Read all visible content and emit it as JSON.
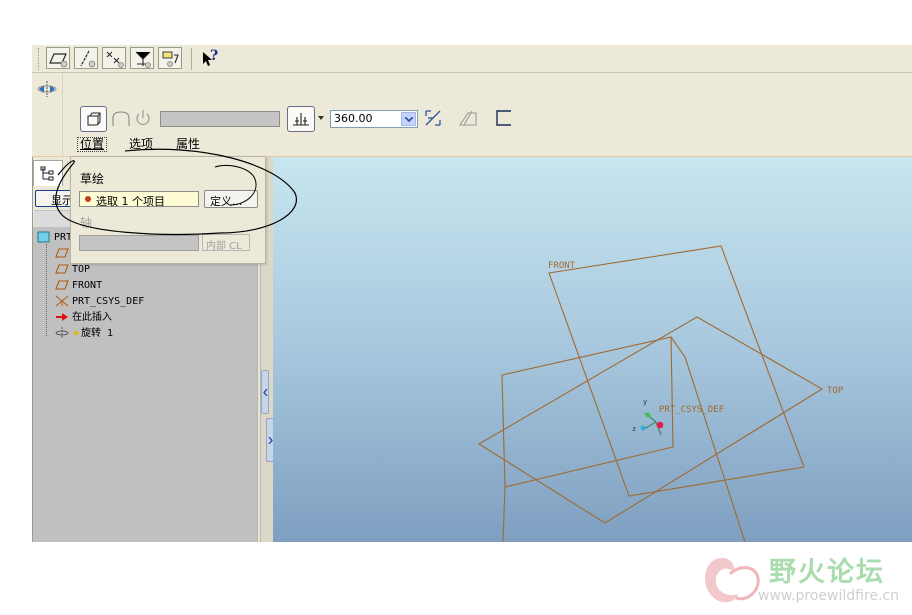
{
  "toolbar": {
    "help_glyph": "?"
  },
  "dashboard": {
    "angle_value": "360.00",
    "tabs": [
      {
        "label": "位置"
      },
      {
        "label": "选项"
      },
      {
        "label": "属性"
      }
    ]
  },
  "placement_panel": {
    "sketch_label": "草绘",
    "sketch_collector": "选取 1 个项目",
    "define_button": "定义...",
    "axis_label": "轴",
    "internal_button": "内部 CL"
  },
  "model_tree": {
    "show_button": "显示",
    "root_label": "PRT",
    "items": [
      {
        "label": "TOP"
      },
      {
        "label": "FRONT"
      },
      {
        "label": "PRT_CSYS_DEF"
      },
      {
        "label": "在此插入"
      },
      {
        "label": "旋转 1"
      }
    ]
  },
  "viewport": {
    "datum_front": "FRONT",
    "datum_top": "TOP",
    "csys_label": "PRT_CSYS_DEF",
    "axis_y": "y",
    "axis_z": "z"
  },
  "watermark": {
    "title": "野火论坛",
    "url": "www.proewildfire.cn"
  },
  "colors": {
    "datum": "#a06a30",
    "viewport_top": "#c7e5ee",
    "viewport_bottom": "#7d9ebf",
    "panel_bg": "#ece9d8"
  }
}
